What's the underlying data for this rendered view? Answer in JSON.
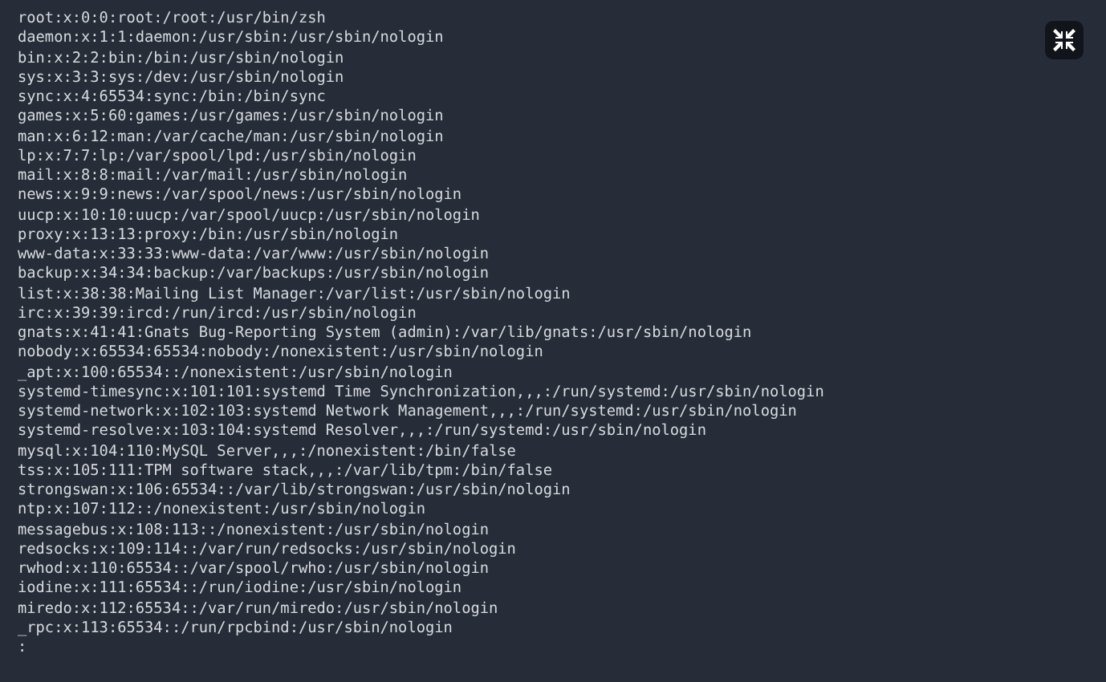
{
  "terminal": {
    "lines": [
      "root:x:0:0:root:/root:/usr/bin/zsh",
      "daemon:x:1:1:daemon:/usr/sbin:/usr/sbin/nologin",
      "bin:x:2:2:bin:/bin:/usr/sbin/nologin",
      "sys:x:3:3:sys:/dev:/usr/sbin/nologin",
      "sync:x:4:65534:sync:/bin:/bin/sync",
      "games:x:5:60:games:/usr/games:/usr/sbin/nologin",
      "man:x:6:12:man:/var/cache/man:/usr/sbin/nologin",
      "lp:x:7:7:lp:/var/spool/lpd:/usr/sbin/nologin",
      "mail:x:8:8:mail:/var/mail:/usr/sbin/nologin",
      "news:x:9:9:news:/var/spool/news:/usr/sbin/nologin",
      "uucp:x:10:10:uucp:/var/spool/uucp:/usr/sbin/nologin",
      "proxy:x:13:13:proxy:/bin:/usr/sbin/nologin",
      "www-data:x:33:33:www-data:/var/www:/usr/sbin/nologin",
      "backup:x:34:34:backup:/var/backups:/usr/sbin/nologin",
      "list:x:38:38:Mailing List Manager:/var/list:/usr/sbin/nologin",
      "irc:x:39:39:ircd:/run/ircd:/usr/sbin/nologin",
      "gnats:x:41:41:Gnats Bug-Reporting System (admin):/var/lib/gnats:/usr/sbin/nologin",
      "nobody:x:65534:65534:nobody:/nonexistent:/usr/sbin/nologin",
      "_apt:x:100:65534::/nonexistent:/usr/sbin/nologin",
      "systemd-timesync:x:101:101:systemd Time Synchronization,,,:/run/systemd:/usr/sbin/nologin",
      "systemd-network:x:102:103:systemd Network Management,,,:/run/systemd:/usr/sbin/nologin",
      "systemd-resolve:x:103:104:systemd Resolver,,,:/run/systemd:/usr/sbin/nologin",
      "mysql:x:104:110:MySQL Server,,,:/nonexistent:/bin/false",
      "tss:x:105:111:TPM software stack,,,:/var/lib/tpm:/bin/false",
      "strongswan:x:106:65534::/var/lib/strongswan:/usr/sbin/nologin",
      "ntp:x:107:112::/nonexistent:/usr/sbin/nologin",
      "messagebus:x:108:113::/nonexistent:/usr/sbin/nologin",
      "redsocks:x:109:114::/var/run/redsocks:/usr/sbin/nologin",
      "rwhod:x:110:65534::/var/spool/rwho:/usr/sbin/nologin",
      "iodine:x:111:65534::/run/iodine:/usr/sbin/nologin",
      "miredo:x:112:65534::/var/run/miredo:/usr/sbin/nologin",
      "_rpc:x:113:65534::/run/rpcbind:/usr/sbin/nologin"
    ],
    "prompt": ":"
  }
}
